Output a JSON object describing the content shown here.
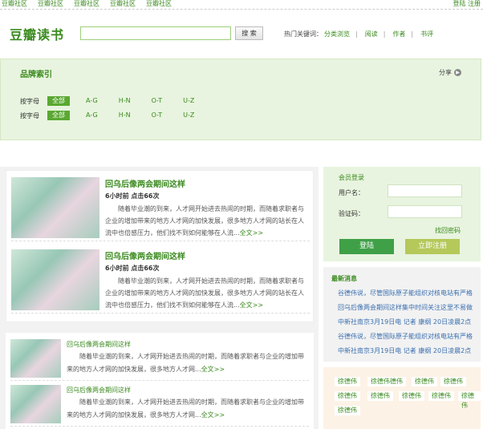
{
  "topbar": {
    "links": [
      "豆瓣社区",
      "豆瓣社区",
      "豆瓣社区",
      "豆瓣社区",
      "豆瓣社区"
    ],
    "auth": "登陆 注册"
  },
  "header": {
    "logo": "豆瓣读书",
    "search_placeholder": "",
    "search_button": "搜 索",
    "hot_label": "热门关键词：",
    "hot_keywords": [
      "分类浏览",
      "阅读",
      "作者",
      "书评"
    ]
  },
  "brand_index": {
    "title": "品牌索引",
    "share": "分享",
    "share_icon": "chevron-right-icon",
    "rows": [
      {
        "label": "按字母",
        "items": [
          "全部",
          "A-G",
          "H-N",
          "O-T",
          "U-Z"
        ],
        "active": "全部"
      },
      {
        "label": "按字母",
        "items": [
          "全部",
          "A-G",
          "H-N",
          "O-T",
          "U-Z"
        ],
        "active": "全部"
      }
    ]
  },
  "articles_main": [
    {
      "title": "回乌后像两会期间这样",
      "meta": "6小时前 点击66次",
      "excerpt": "随着毕业潮的到来，人才网开始进去热闹的时期，而随着求职者与企业的增加带来的地方人才网的加快发展，很多地方人才网的站长在人流中也倍感压力，他们找不到如何能够在人流...",
      "more": "全文>>"
    },
    {
      "title": "回乌后像两会期间这样",
      "meta": "6小时前 点击66次",
      "excerpt": "随着毕业潮的到来，人才网开始进去热闹的时期，而随着求职者与企业的增加带来的地方人才网的加快发展，很多地方人才网的站长在人流中也倍感压力，他们找不到如何能够在人流...",
      "more": "全文>>"
    }
  ],
  "articles_small": [
    {
      "title": "回乌后像两会期间这样",
      "excerpt": "随着毕业潮的到来，人才网开始进去热闹的时期，而随着求职者与企业的增加带来的地方人才网的加快发展，很多地方人才网...",
      "more": "全文>>"
    },
    {
      "title": "回乌后像两会期间这样",
      "excerpt": "随着毕业潮的到来，人才网开始进去热闹的时期，而随着求职者与企业的增加带来的地方人才网的加快发展，很多地方人才网...",
      "more": "全文>>"
    }
  ],
  "login": {
    "heading": "会员登录",
    "username_label": "用户名：",
    "captcha_label": "验证码：",
    "forgot": "找回密码",
    "login_button": "登陆",
    "register_button": "立即注册"
  },
  "news": {
    "heading": "最新消息",
    "items": [
      "谷德伟说，尽管国际原子能组织对核电站有严格",
      "回乌后像两会期间这样集中时间关注这里不易做",
      "中新社南京3月19日电 记者 康纲 20日凌晨2点",
      "谷德伟说，尽管国际原子能组织对核电站有严格",
      "中新社南京3月19日电 记者 康纲 20日凌晨2点"
    ]
  },
  "tags": [
    "徐德伟",
    "徐德伟德伟",
    "徐德伟",
    "徐德伟",
    "徐德伟",
    "徐德伟",
    "徐德伟",
    "徐德伟",
    "徐德伟",
    "徐德伟"
  ],
  "colors": {
    "brand_green": "#3a8a1e",
    "panel_green": "#e8f4df",
    "login_button": "#3fa048",
    "register_button": "#b5c85a",
    "news_link": "#3a6fb0"
  }
}
